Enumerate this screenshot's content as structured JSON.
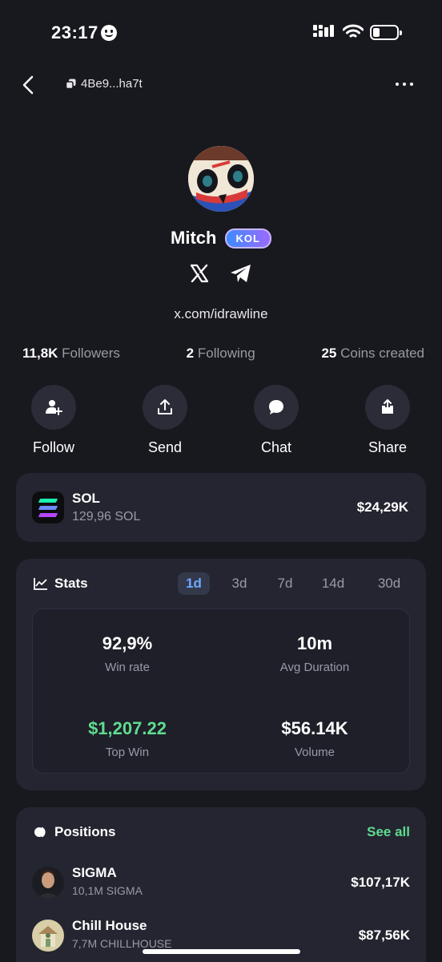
{
  "status_bar": {
    "time": "23:17"
  },
  "nav": {
    "address": "4Be9...ha7t"
  },
  "profile": {
    "name": "Mitch",
    "badge": "KOL",
    "link": "x.com/idrawline"
  },
  "counts": [
    {
      "value": "11,8K",
      "label": "Followers"
    },
    {
      "value": "2",
      "label": "Following"
    },
    {
      "value": "25",
      "label": "Coins created"
    }
  ],
  "actions": [
    {
      "label": "Follow",
      "icon": "add-user-icon"
    },
    {
      "label": "Send",
      "icon": "upload-icon"
    },
    {
      "label": "Chat",
      "icon": "chat-bubble-icon"
    },
    {
      "label": "Share",
      "icon": "share-icon"
    }
  ],
  "balance": {
    "token": "SOL",
    "amount": "129,96 SOL",
    "value": "$24,29K"
  },
  "stats": {
    "title": "Stats",
    "periods": [
      "1d",
      "3d",
      "7d",
      "14d",
      "30d"
    ],
    "active_period": "1d",
    "items": [
      {
        "value": "92,9%",
        "label": "Win rate"
      },
      {
        "value": "10m",
        "label": "Avg Duration"
      },
      {
        "value": "$1,207.22",
        "label": "Top Win"
      },
      {
        "value": "$56.14K",
        "label": "Volume"
      }
    ]
  },
  "positions": {
    "title": "Positions",
    "see_all": "See all",
    "items": [
      {
        "name": "SIGMA",
        "amount": "10,1M SIGMA",
        "value": "$107,17K"
      },
      {
        "name": "Chill House",
        "amount": "7,7M CHILLHOUSE",
        "value": "$87,56K"
      }
    ]
  },
  "colors": {
    "background": "#18181f",
    "card": "#242530",
    "accent_green": "#5fdc8f",
    "accent_blue": "#6fa8ff"
  }
}
